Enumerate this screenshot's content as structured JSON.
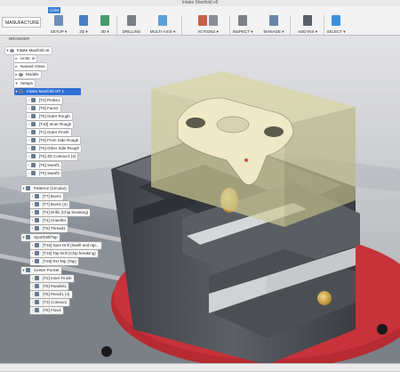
{
  "window": {
    "title": "Intake Manifold v6"
  },
  "toolbar": {
    "workspace_label": "MANUFACTURE",
    "active_tab": "CAM",
    "groups": [
      {
        "label": "SETUP ▾",
        "icon": "setup-icon"
      },
      {
        "label": "2D ▾",
        "icon": "2d-icon"
      },
      {
        "label": "3D ▾",
        "icon": "3d-icon"
      },
      {
        "label": "DRILLING",
        "icon": "drilling-icon"
      },
      {
        "label": "MULTI-AXIS ▾",
        "icon": "multi-axis-icon"
      },
      {
        "label": "ACTIONS ▾",
        "icon": "actions-icon"
      },
      {
        "label": "INSPECT ▾",
        "icon": "inspect-icon"
      },
      {
        "label": "MANAGE ▾",
        "icon": "manage-icon"
      },
      {
        "label": "ADD-INS ▾",
        "icon": "add-ins-icon"
      },
      {
        "label": "SELECT ▾",
        "icon": "select-icon"
      }
    ]
  },
  "browser": {
    "header": "BROWSER",
    "rows": [
      {
        "label": "Intake Manifold v6"
      },
      {
        "label": "Units: in"
      },
      {
        "label": "Named Views"
      },
      {
        "label": "Models"
      },
      {
        "label": "Setups"
      },
      {
        "label": "Intake Manifold OP 1"
      },
      {
        "label": "[T2] Probe1"
      },
      {
        "label": "[T5] Face2"
      },
      {
        "label": "[T5] Outer Rough"
      },
      {
        "label": "[T10] Inner Rough"
      },
      {
        "label": "[T1] Outer Finish"
      },
      {
        "label": "[T5] From Side Rough"
      },
      {
        "label": "[T5] Other Side Rough"
      },
      {
        "label": "[T5] 3D Contour1 (4)"
      },
      {
        "label": "[T5] Swarf1"
      },
      {
        "label": "[T5] Swarf2"
      },
      {
        "label": "Pattern2 (Circular)"
      },
      {
        "label": "[T7] Bore1"
      },
      {
        "label": "[T7] Bore1 (2)"
      },
      {
        "label": "[T4] Drill1 (Chip breaking)"
      },
      {
        "label": "[T4] Chamfer"
      },
      {
        "label": "[T8] Thread1"
      },
      {
        "label": "Spot/Drill/Tap"
      },
      {
        "label": "[T16] Spot Drill (Swell and rap..."
      },
      {
        "label": "[T15] Tap Drill (Chip breaking)"
      },
      {
        "label": "[T26] RH Tap (Tap)"
      },
      {
        "label": "Center Pocket"
      },
      {
        "label": "[T2] Inner Finish"
      },
      {
        "label": "[T6] Parallel1"
      },
      {
        "label": "[T6] Pencil1 (4)"
      },
      {
        "label": "[T3] Contour2"
      },
      {
        "label": "[T6] Flow1"
      }
    ]
  },
  "colors": {
    "accent": "#2f6fd6",
    "table_red": "#c8323a",
    "vise_gray": "#4a4d52",
    "brass": "#c8a24a",
    "stock": "#d8d6a0"
  }
}
